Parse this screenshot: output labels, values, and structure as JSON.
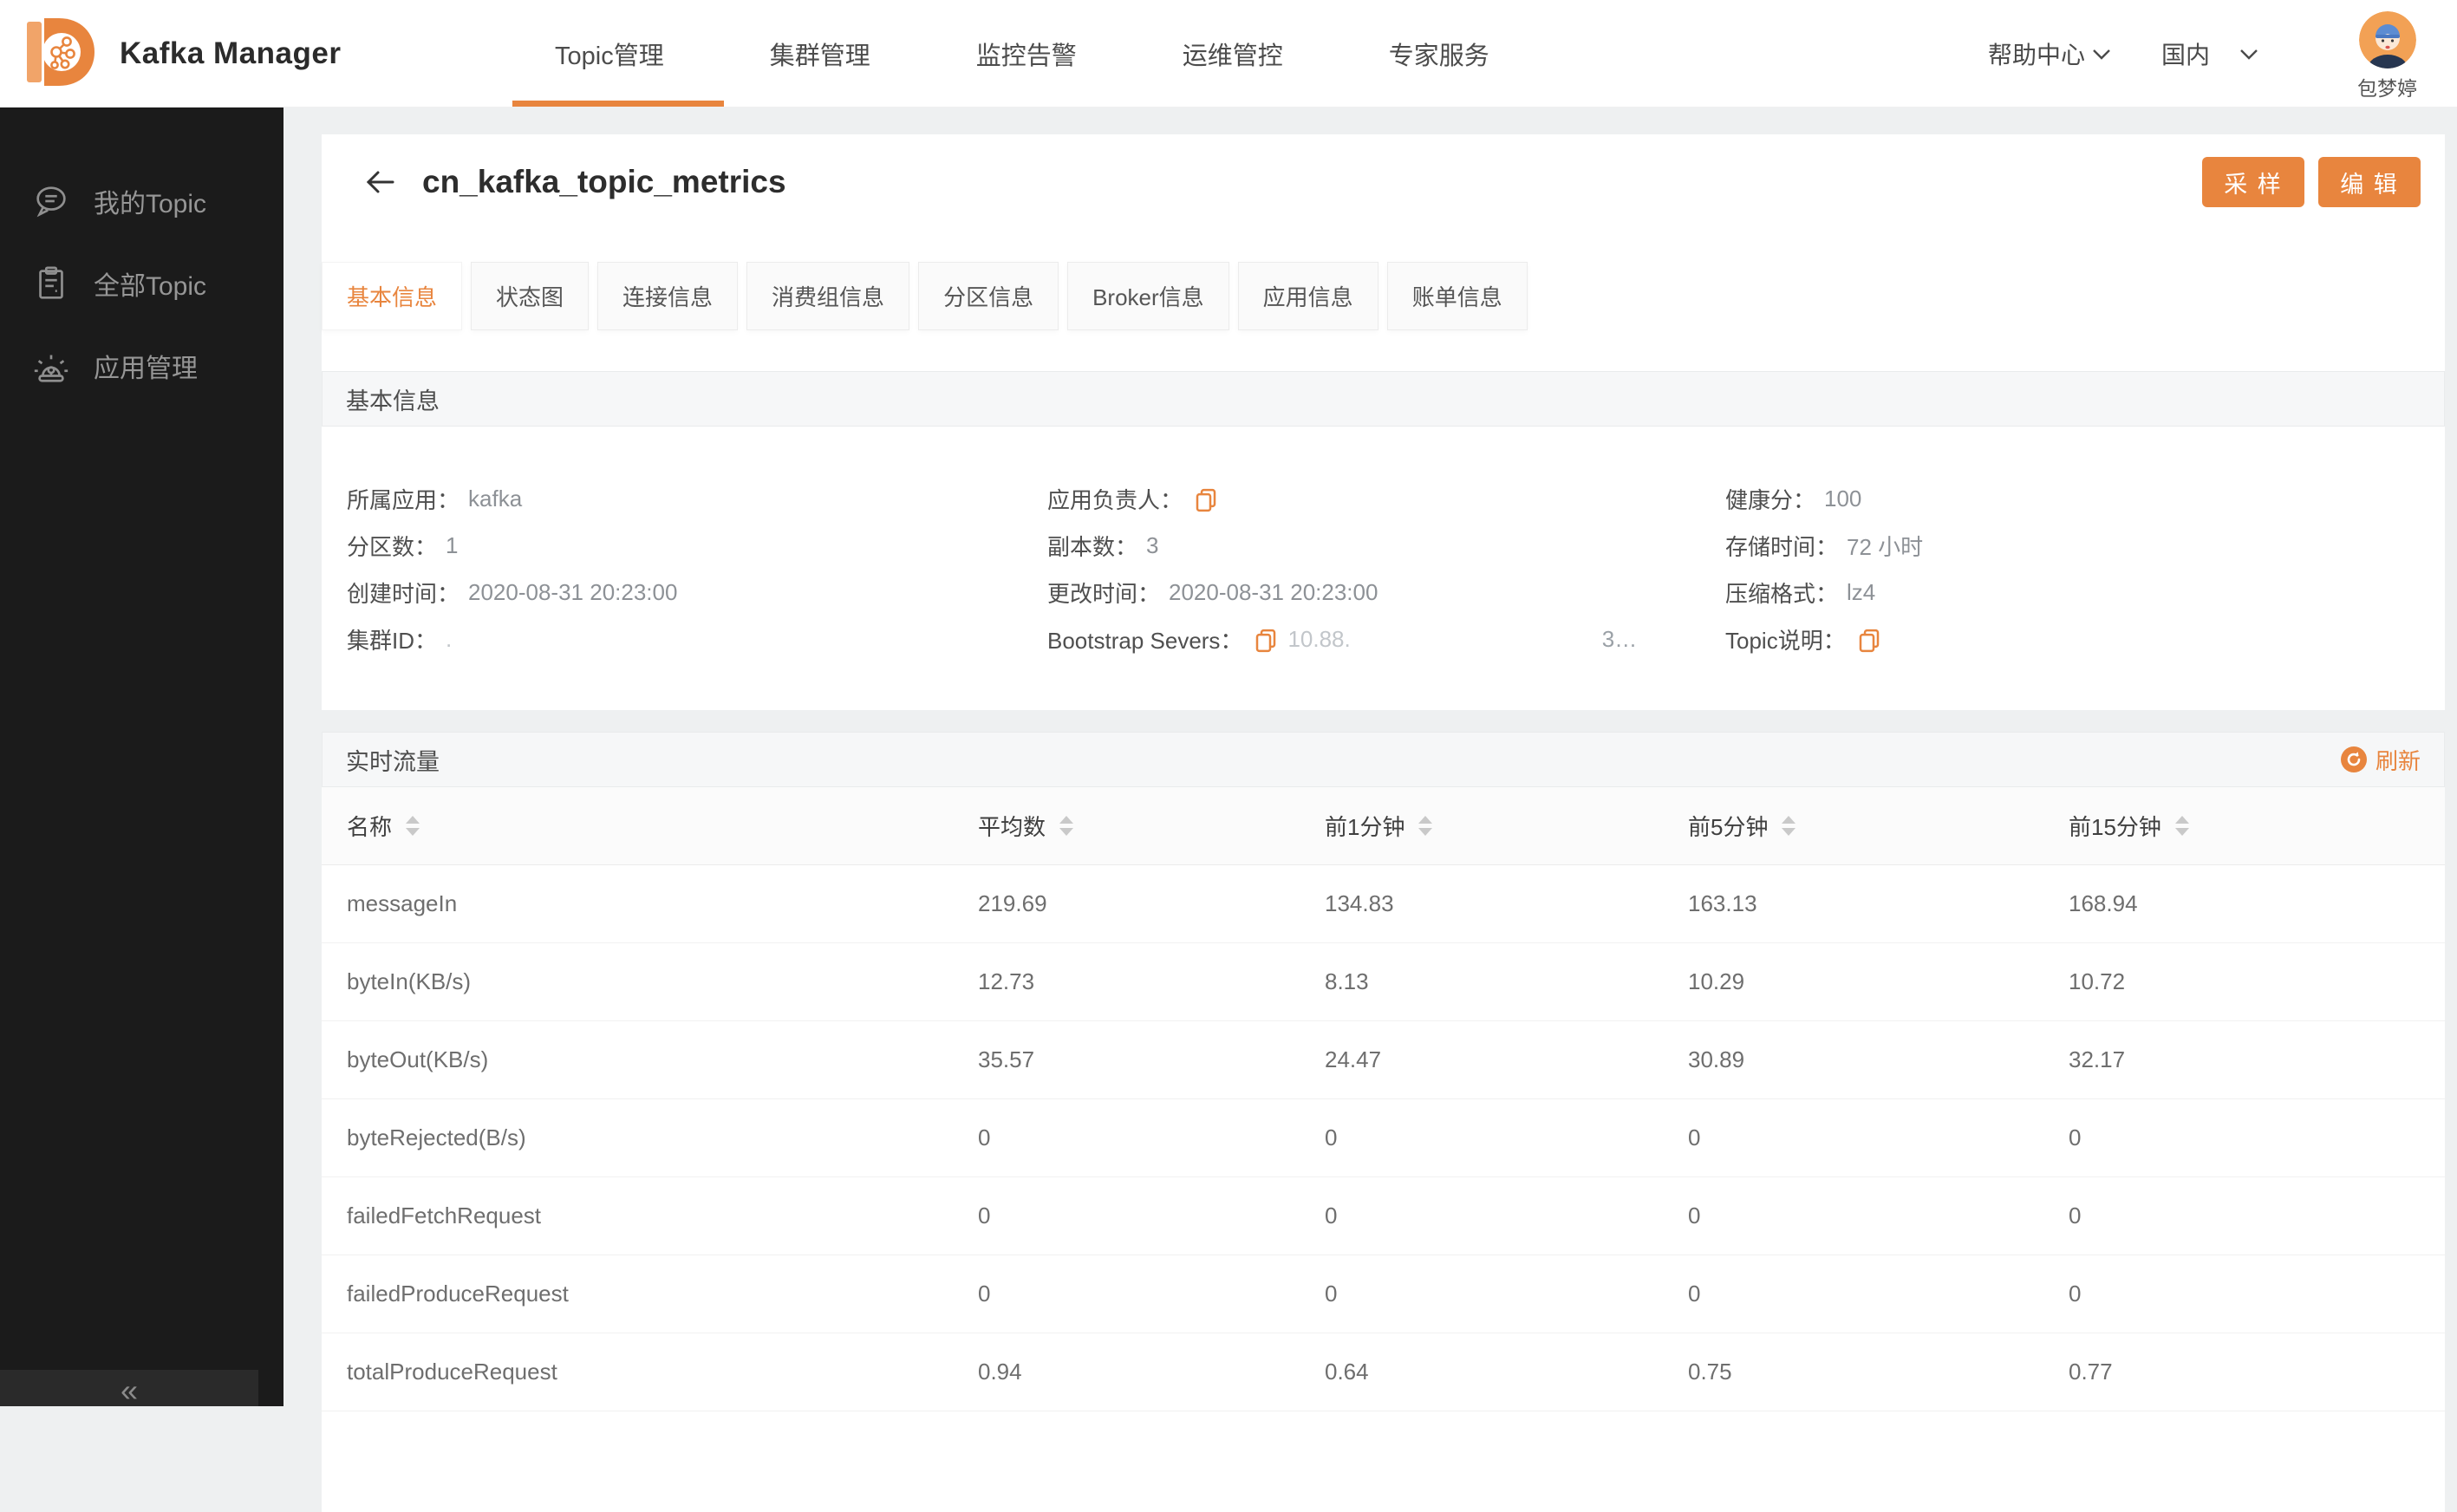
{
  "colors": {
    "accent": "#E8853E",
    "sidebar_bg": "#1b1b1b",
    "page_bg": "#eef0f1"
  },
  "header": {
    "brand": "Kafka Manager",
    "nav": [
      {
        "label": "Topic管理"
      },
      {
        "label": "集群管理"
      },
      {
        "label": "监控告警"
      },
      {
        "label": "运维管控"
      },
      {
        "label": "专家服务"
      }
    ],
    "help_center": "帮助中心",
    "region": "国内",
    "username": "包梦婷"
  },
  "sidebar": {
    "items": [
      {
        "label": "我的Topic",
        "icon": "chat-icon"
      },
      {
        "label": "全部Topic",
        "icon": "clipboard-icon"
      },
      {
        "label": "应用管理",
        "icon": "alarm-icon"
      }
    ],
    "collapse_label": "«"
  },
  "page": {
    "title": "cn_kafka_topic_metrics",
    "sample_button": "采 样",
    "edit_button": "编 辑",
    "tabs": [
      {
        "label": "基本信息"
      },
      {
        "label": "状态图"
      },
      {
        "label": "连接信息"
      },
      {
        "label": "消费组信息"
      },
      {
        "label": "分区信息"
      },
      {
        "label": "Broker信息"
      },
      {
        "label": "应用信息"
      },
      {
        "label": "账单信息"
      }
    ]
  },
  "basic_info": {
    "section_title": "基本信息",
    "fields": {
      "app": {
        "label": "所属应用：",
        "value": "kafka"
      },
      "owner": {
        "label": "应用负责人：",
        "value": ""
      },
      "health": {
        "label": "健康分：",
        "value": "100"
      },
      "partitions": {
        "label": "分区数：",
        "value": "1"
      },
      "replicas": {
        "label": "副本数：",
        "value": "3"
      },
      "retention": {
        "label": "存储时间：",
        "value": "72 小时"
      },
      "created": {
        "label": "创建时间：",
        "value": "2020-08-31 20:23:00"
      },
      "modified": {
        "label": "更改时间：",
        "value": "2020-08-31 20:23:00"
      },
      "compression": {
        "label": "压缩格式：",
        "value": "lz4"
      },
      "cluster_id": {
        "label": "集群ID：",
        "value": "."
      },
      "bootstrap": {
        "label": "Bootstrap Severs：",
        "value": "10.88.",
        "value2": "3…"
      },
      "description": {
        "label": "Topic说明：",
        "value": ""
      }
    }
  },
  "realtime": {
    "section_title": "实时流量",
    "refresh_label": "刷新",
    "table": {
      "columns": [
        {
          "label": "名称"
        },
        {
          "label": "平均数"
        },
        {
          "label": "前1分钟"
        },
        {
          "label": "前5分钟"
        },
        {
          "label": "前15分钟"
        }
      ],
      "rows": [
        {
          "name": "messageIn",
          "avg": "219.69",
          "min1": "134.83",
          "min5": "163.13",
          "min15": "168.94"
        },
        {
          "name": "byteIn(KB/s)",
          "avg": "12.73",
          "min1": "8.13",
          "min5": "10.29",
          "min15": "10.72"
        },
        {
          "name": "byteOut(KB/s)",
          "avg": "35.57",
          "min1": "24.47",
          "min5": "30.89",
          "min15": "32.17"
        },
        {
          "name": "byteRejected(B/s)",
          "avg": "0",
          "min1": "0",
          "min5": "0",
          "min15": "0"
        },
        {
          "name": "failedFetchRequest",
          "avg": "0",
          "min1": "0",
          "min5": "0",
          "min15": "0"
        },
        {
          "name": "failedProduceRequest",
          "avg": "0",
          "min1": "0",
          "min5": "0",
          "min15": "0"
        },
        {
          "name": "totalProduceRequest",
          "avg": "0.94",
          "min1": "0.64",
          "min5": "0.75",
          "min15": "0.77"
        }
      ]
    }
  }
}
